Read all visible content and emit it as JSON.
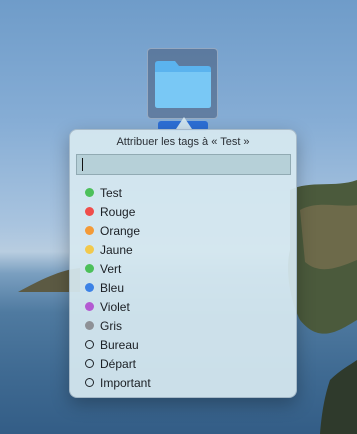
{
  "popover": {
    "title": "Attribuer les tags à « Test »",
    "input_value": ""
  },
  "tags": [
    {
      "label": "Test",
      "color": "#4cc05a",
      "hollow": false
    },
    {
      "label": "Rouge",
      "color": "#ef4d4a",
      "hollow": false
    },
    {
      "label": "Orange",
      "color": "#f39a37",
      "hollow": false
    },
    {
      "label": "Jaune",
      "color": "#f2c94c",
      "hollow": false
    },
    {
      "label": "Vert",
      "color": "#4cc05a",
      "hollow": false
    },
    {
      "label": "Bleu",
      "color": "#3c82e6",
      "hollow": false
    },
    {
      "label": "Violet",
      "color": "#b35ad2",
      "hollow": false
    },
    {
      "label": "Gris",
      "color": "#8e9196",
      "hollow": false
    },
    {
      "label": "Bureau",
      "color": "",
      "hollow": true
    },
    {
      "label": "Départ",
      "color": "",
      "hollow": true
    },
    {
      "label": "Important",
      "color": "",
      "hollow": true
    }
  ],
  "icons": {
    "folder": "folder-icon"
  }
}
